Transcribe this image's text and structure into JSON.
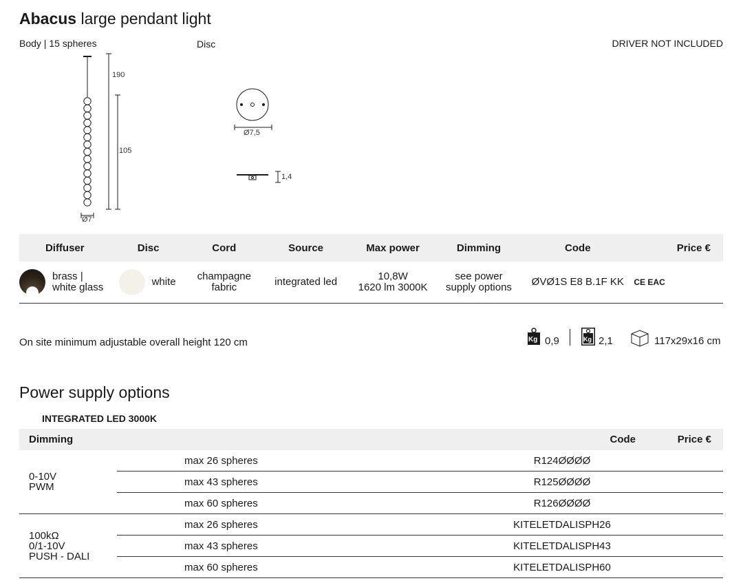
{
  "title": {
    "brand": "Abacus",
    "rest": "large pendant light"
  },
  "labels": {
    "body": "Body | 15 spheres",
    "disc": "Disc",
    "driver": "DRIVER NOT INCLUDED"
  },
  "dimensions": {
    "cord": "190",
    "body": "105",
    "sphere_diameter": "Ø7",
    "disc_diameter": "Ø7,5",
    "disc_thickness": "1,4"
  },
  "product_table": {
    "headers": [
      "Diffuser",
      "Disc",
      "Cord",
      "Source",
      "Max power",
      "Dimming",
      "Code",
      "",
      "Price €"
    ],
    "row": {
      "diffuser_l1": "brass |",
      "diffuser_l2": "white glass",
      "disc": "white",
      "cord_l1": "champagne",
      "cord_l2": "fabric",
      "source": "integrated led",
      "power_l1": "10,8W",
      "power_l2": "1620 lm 3000K",
      "dimming_l1": "see power",
      "dimming_l2": "supply options",
      "code": "ØVØ1S E8 B.1F KK",
      "marks": "CE EAC",
      "price": ""
    }
  },
  "note": "On site minimum adjustable overall height 120 cm",
  "weights": {
    "kg_label": "Kg",
    "net": "0,9",
    "gross": "2,1",
    "box": "117x29x16 cm"
  },
  "power_supply": {
    "heading": "Power supply options",
    "subheading": "INTEGRATED LED 3000K",
    "headers": {
      "dimming": "Dimming",
      "code": "Code",
      "price": "Price €"
    },
    "groups": [
      {
        "label_lines": [
          "0-10V",
          "PWM"
        ],
        "rows": [
          {
            "spheres": "max 26 spheres",
            "code": "R124ØØØØ"
          },
          {
            "spheres": "max 43 spheres",
            "code": "R125ØØØØ"
          },
          {
            "spheres": "max 60 spheres",
            "code": "R126ØØØØ"
          }
        ]
      },
      {
        "label_lines": [
          "100kΩ",
          "0/1-10V",
          "PUSH - DALI"
        ],
        "rows": [
          {
            "spheres": "max 26 spheres",
            "code": "KITELETDALISPH26"
          },
          {
            "spheres": "max 43 spheres",
            "code": "KITELETDALISPH43"
          },
          {
            "spheres": "max 60 spheres",
            "code": "KITELETDALISPH60"
          }
        ]
      }
    ]
  },
  "colors": {
    "header_bg": "#efefef",
    "rule": "#333333",
    "text": "#1a1a1a"
  }
}
